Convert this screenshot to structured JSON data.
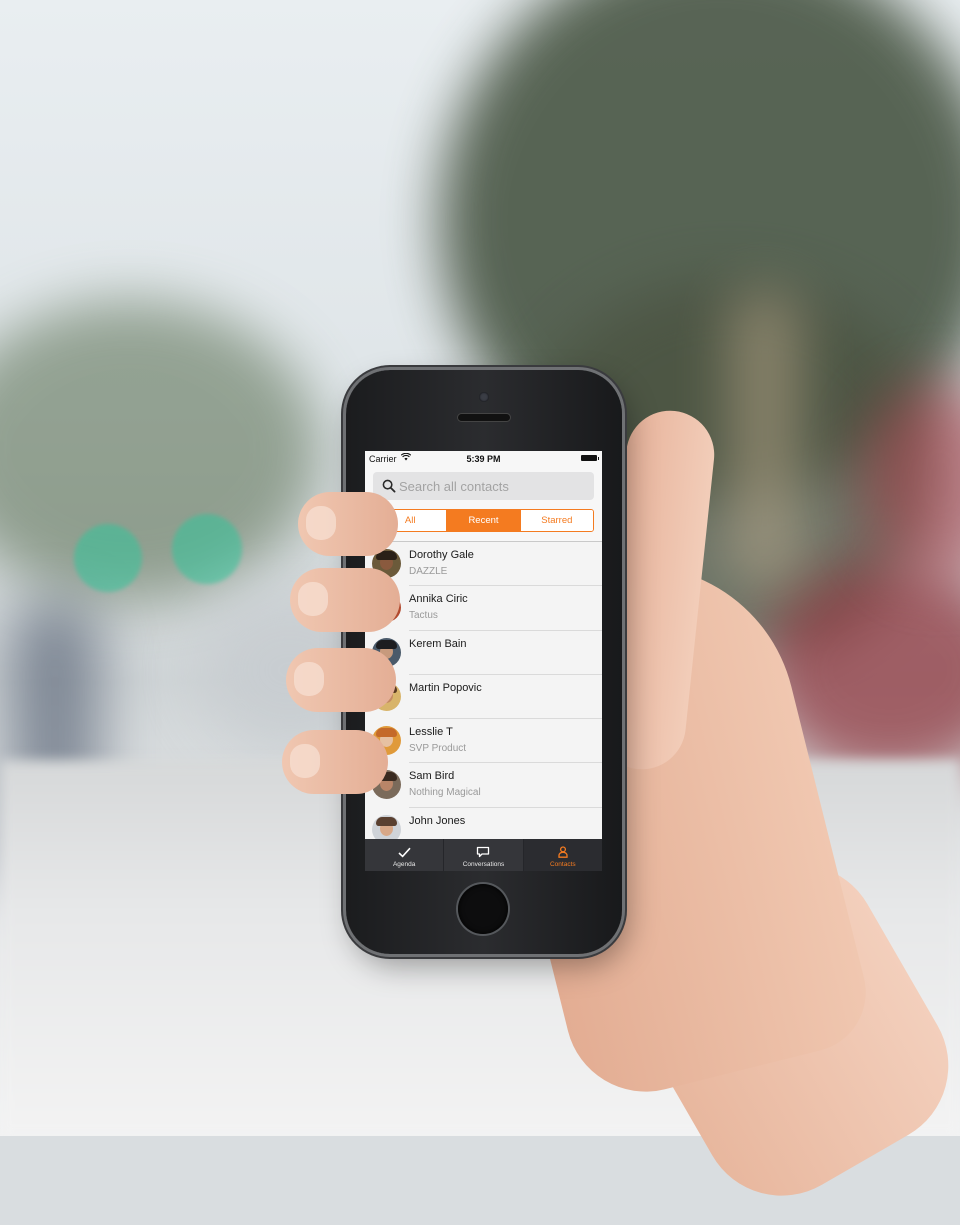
{
  "status_bar": {
    "carrier": "Carrier",
    "wifi_icon": "wifi-icon",
    "time": "5:39 PM",
    "battery_icon": "battery-icon"
  },
  "search": {
    "placeholder": "Search all contacts",
    "icon": "search-icon"
  },
  "segments": {
    "items": [
      {
        "label": "All",
        "active": false
      },
      {
        "label": "Recent",
        "active": true
      },
      {
        "label": "Starred",
        "active": false
      }
    ]
  },
  "contacts": [
    {
      "name": "Dorothy Gale",
      "subtitle": "DAZZLE"
    },
    {
      "name": "Annika Ciric",
      "subtitle": "Tactus"
    },
    {
      "name": "Kerem Bain",
      "subtitle": ""
    },
    {
      "name": "Martin Popovic",
      "subtitle": ""
    },
    {
      "name": "Lesslie T",
      "subtitle": "SVP Product"
    },
    {
      "name": "Sam Bird",
      "subtitle": "Nothing Magical"
    },
    {
      "name": "John Jones",
      "subtitle": ""
    }
  ],
  "tabbar": {
    "items": [
      {
        "label": "Agenda",
        "icon": "checkmark-icon",
        "active": false
      },
      {
        "label": "Conversations",
        "icon": "chat-bubble-icon",
        "active": false
      },
      {
        "label": "Contacts",
        "icon": "person-icon",
        "active": true
      }
    ]
  },
  "colors": {
    "accent": "#f47b20",
    "tabbar_bg": "#35363a",
    "list_bg": "#f4f4f4"
  }
}
